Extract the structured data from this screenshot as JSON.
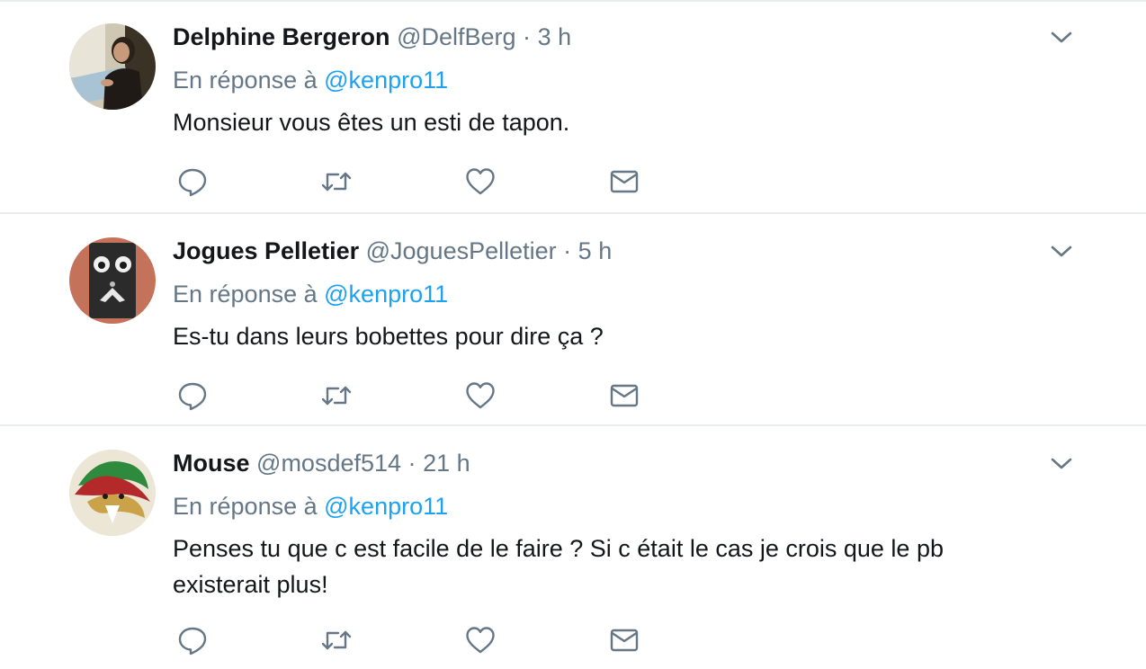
{
  "colors": {
    "accent": "#1da1f2",
    "muted": "#657786",
    "text": "#14171a",
    "divider": "#e6ecf0"
  },
  "icons": {
    "reply": "reply-icon",
    "retweet": "retweet-icon",
    "like": "heart-icon",
    "dm": "envelope-icon",
    "more": "chevron-down-icon"
  },
  "tweets": [
    {
      "fullname": "Delphine Bergeron",
      "handle": "@DelfBerg",
      "dot": "·",
      "time": "3 h",
      "reply_prefix": "En réponse à",
      "reply_to": "@kenpro11",
      "text": "Monsieur vous êtes un esti de tapon."
    },
    {
      "fullname": "Jogues Pelletier",
      "handle": "@JoguesPelletier",
      "dot": "·",
      "time": "5 h",
      "reply_prefix": "En réponse à",
      "reply_to": "@kenpro11",
      "text": "Es-tu dans leurs bobettes pour dire ça ?"
    },
    {
      "fullname": "Mouse",
      "handle": "@mosdef514",
      "dot": "·",
      "time": "21 h",
      "reply_prefix": "En réponse à",
      "reply_to": "@kenpro11",
      "text": "Penses tu que c est facile de le faire ? Si c était le cas je crois que le pb existerait plus!"
    }
  ]
}
